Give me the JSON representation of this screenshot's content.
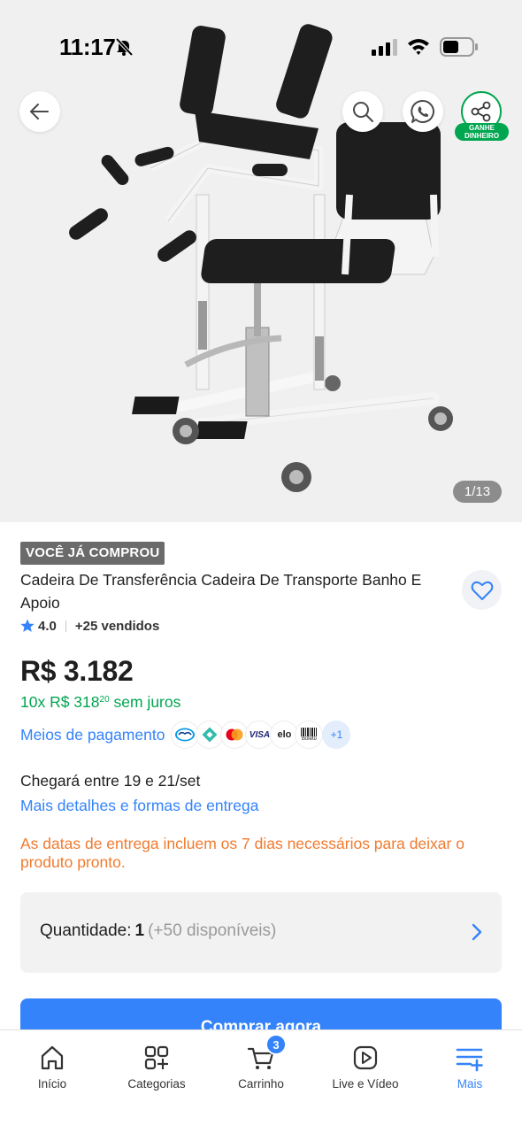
{
  "status_bar": {
    "time": "11:17"
  },
  "gallery": {
    "counter": "1/13",
    "share_badge": "GANHE\nDINHEIRO"
  },
  "product": {
    "tag": "VOCÊ JÁ COMPROU",
    "title": "Cadeira De Transferência Cadeira De Transporte Banho E Apoio",
    "rating": "4.0",
    "sold": "+25 vendidos",
    "price": "R$ 3.182",
    "installments_prefix": "10x R$ 318",
    "installments_cents": "20",
    "installments_suffix": " sem juros"
  },
  "payment": {
    "link": "Meios de pagamento",
    "icons": [
      "mercado-pago-icon",
      "pix-icon",
      "mastercard-icon",
      "visa-icon",
      "elo-icon",
      "boleto-icon"
    ],
    "visa_text": "VISA",
    "elo_text": "elo",
    "boleto_text": "Boleto",
    "more": "+1"
  },
  "delivery": {
    "text": "Chegará entre 19 e 21/set",
    "link": "Mais detalhes e formas de entrega",
    "notice": "As datas de entrega incluem os 7 dias necessários para deixar o produto pronto."
  },
  "quantity": {
    "label": "Quantidade:",
    "value": "1",
    "available": "(+50 disponíveis)"
  },
  "buy_button": "Comprar agora",
  "bottom_nav": {
    "items": [
      {
        "label": "Início",
        "icon": "home-icon"
      },
      {
        "label": "Categorias",
        "icon": "categories-icon"
      },
      {
        "label": "Carrinho",
        "icon": "cart-icon",
        "badge": "3"
      },
      {
        "label": "Live e Vídeo",
        "icon": "play-icon"
      },
      {
        "label": "Mais",
        "icon": "menu-plus-icon",
        "active": true
      }
    ]
  },
  "colors": {
    "accent": "#3483fa",
    "green": "#00a650",
    "orange": "#f07b30"
  }
}
